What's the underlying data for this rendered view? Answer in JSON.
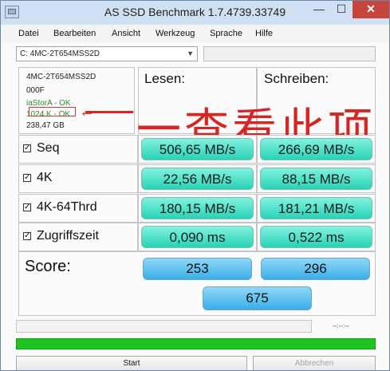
{
  "window": {
    "title": "AS SSD Benchmark 1.7.4739.33749",
    "minimize": "—",
    "maximize": "☐",
    "close": "✕"
  },
  "menu": [
    "Datei",
    "Bearbeiten",
    "Ansicht",
    "Werkzeug",
    "Sprache",
    "Hilfe"
  ],
  "drive": {
    "selected": "C: 4MC-2T654MSS2D"
  },
  "info": {
    "model": "4MC-2T654MSS2D",
    "firmware": "000F",
    "driver": "iaStorA - OK",
    "alignment": "1024 K - OK",
    "size": "238,47 GB"
  },
  "headers": {
    "read": "Lesen:",
    "write": "Schreiben:"
  },
  "rows": [
    {
      "label": "Seq",
      "checked": true,
      "read": "506,65 MB/s",
      "write": "266,69 MB/s"
    },
    {
      "label": "4K",
      "checked": true,
      "read": "22,56 MB/s",
      "write": "88,15 MB/s"
    },
    {
      "label": "4K-64Thrd",
      "checked": true,
      "read": "180,15 MB/s",
      "write": "181,21 MB/s"
    },
    {
      "label": "Zugriffszeit",
      "checked": true,
      "read": "0,090 ms",
      "write": "0,522 ms"
    }
  ],
  "score": {
    "label": "Score:",
    "read": "253",
    "write": "296",
    "total": "675"
  },
  "progress": {
    "time": "--:--:--",
    "value": 1.0
  },
  "buttons": {
    "start": "Start",
    "abort": "Abbrechen"
  },
  "annotation": {
    "text": "一查看此项"
  },
  "colors": {
    "result_green": "#27d3b5",
    "score_blue": "#3aaee7",
    "progress_green": "#1fc41f",
    "annotation_red": "#d92424"
  }
}
